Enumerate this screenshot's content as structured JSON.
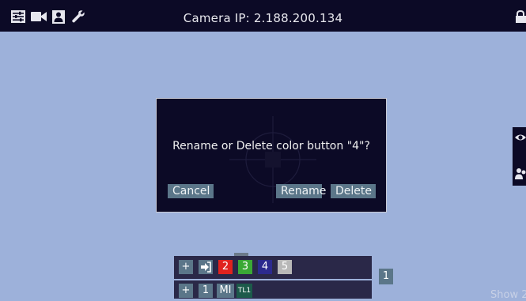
{
  "topbar": {
    "title": "Camera IP: 2.188.200.134",
    "icons": [
      "sliders-icon",
      "video-camera-icon",
      "user-icon",
      "wrench-icon",
      "lock-icon"
    ]
  },
  "dialog": {
    "message": "Rename or Delete color button \"4\"?",
    "cancel_label": "Cancel",
    "rename_label": "Rename",
    "delete_label": "Delete"
  },
  "color_bar": {
    "add_label": "+",
    "buttons": [
      {
        "label": "2",
        "color": "#e0221e"
      },
      {
        "label": "3",
        "color": "#3aa835"
      },
      {
        "label": "4",
        "color": "#2c2a8e"
      },
      {
        "label": "5",
        "color": "#b8b8b8"
      }
    ]
  },
  "preset_bar": {
    "add_label": "+",
    "items": [
      "1",
      "MI",
      "TL1"
    ]
  },
  "side_number": "1",
  "show_text": "Show 2"
}
